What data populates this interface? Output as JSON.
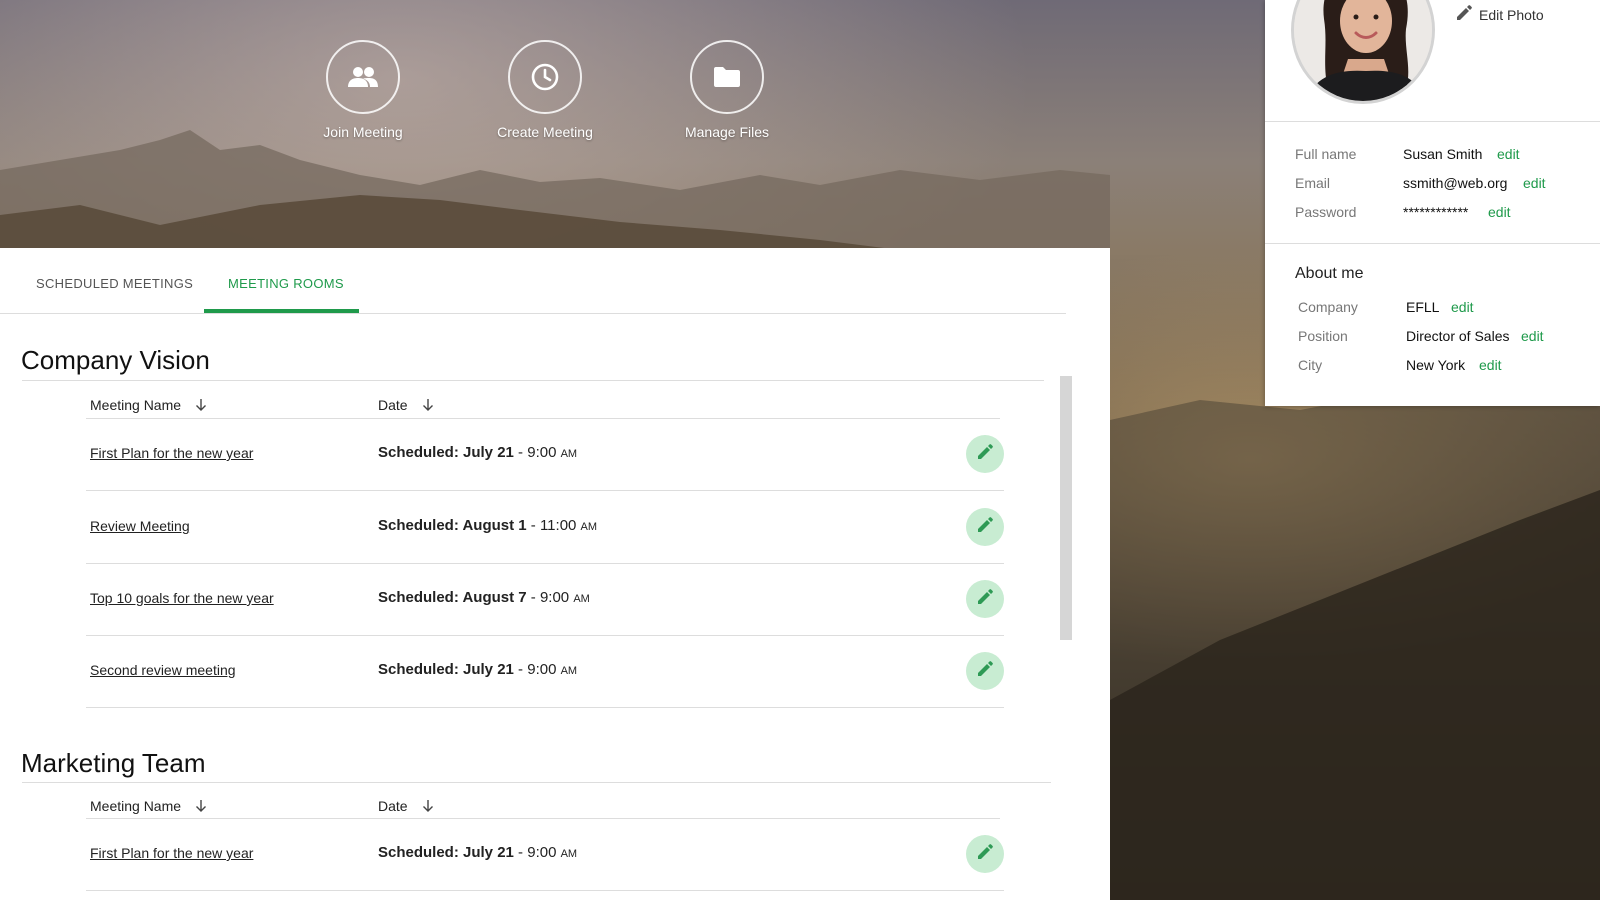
{
  "hero": {
    "actions": [
      {
        "label": "Join Meeting",
        "icon": "people-icon"
      },
      {
        "label": "Create Meeting",
        "icon": "clock-icon"
      },
      {
        "label": "Manage Files",
        "icon": "folder-icon"
      }
    ]
  },
  "tabs": [
    {
      "label": "SCHEDULED MEETINGS",
      "active": false
    },
    {
      "label": "MEETING ROOMS",
      "active": true
    }
  ],
  "columns": {
    "name": "Meeting Name",
    "date": "Date"
  },
  "sections": [
    {
      "title": "Company Vision",
      "meetings": [
        {
          "name": "First Plan for the new year",
          "prefix": "Scheduled: July 21",
          "time": " - 9:00 ",
          "ampm": "AM"
        },
        {
          "name": "Review Meeting",
          "prefix": "Scheduled: August 1",
          "time": " - 11:00 ",
          "ampm": "AM"
        },
        {
          "name": "Top 10 goals for the new year",
          "prefix": "Scheduled: August 7",
          "time": " - 9:00 ",
          "ampm": "AM"
        },
        {
          "name": "Second review meeting",
          "prefix": "Scheduled: July 21",
          "time": " - 9:00 ",
          "ampm": "AM"
        }
      ]
    },
    {
      "title": "Marketing Team",
      "meetings": [
        {
          "name": "First Plan for the new year",
          "prefix": "Scheduled: July 21",
          "time": " - 9:00 ",
          "ampm": "AM"
        }
      ]
    }
  ],
  "profile": {
    "edit_photo": "Edit Photo",
    "edit_label": "edit",
    "account": [
      {
        "label": "Full name",
        "value": "Susan Smith"
      },
      {
        "label": "Email",
        "value": "ssmith@web.org"
      },
      {
        "label": "Password",
        "value": "************"
      }
    ],
    "about_title": "About me",
    "about": [
      {
        "label": "Company",
        "value": "EFLL"
      },
      {
        "label": "Position",
        "value": "Director of Sales"
      },
      {
        "label": "City",
        "value": "New York"
      }
    ]
  },
  "colors": {
    "accent": "#1f9a4b",
    "edit_button_bg": "#c8ecd2"
  }
}
